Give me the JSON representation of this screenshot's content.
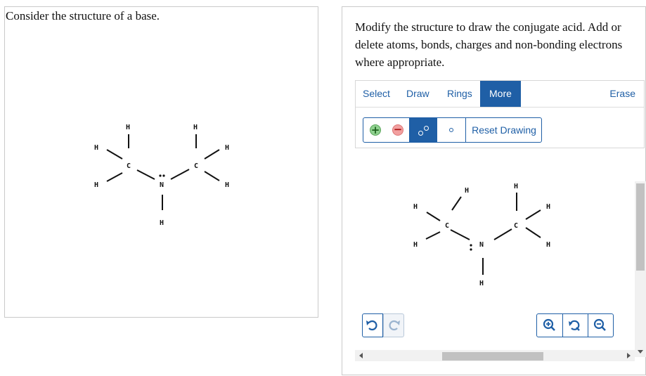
{
  "left": {
    "prompt": "Consider the structure of a base."
  },
  "right": {
    "instructions": "Modify the structure to draw the conjugate acid. Add or delete atoms, bonds, charges and non-bonding electrons where appropriate.",
    "tabs": {
      "select": "Select",
      "draw": "Draw",
      "rings": "Rings",
      "more": "More",
      "erase": "Erase"
    },
    "tools": {
      "add_charge": "+",
      "remove_charge": "−",
      "reset": "Reset Drawing"
    },
    "icons": [
      "plus-charge-icon",
      "minus-charge-icon",
      "electron-pair-icon",
      "single-electron-icon",
      "undo-icon",
      "redo-icon",
      "zoom-in-icon",
      "zoom-reset-icon",
      "zoom-out-icon"
    ],
    "colors": {
      "accent": "#1f5fa6",
      "plus": "#8fd18f",
      "minus": "#f2a0a0"
    }
  },
  "molecule": {
    "atoms": {
      "H": "H",
      "C": "C",
      "N": "N"
    },
    "lone_pair": ":"
  }
}
